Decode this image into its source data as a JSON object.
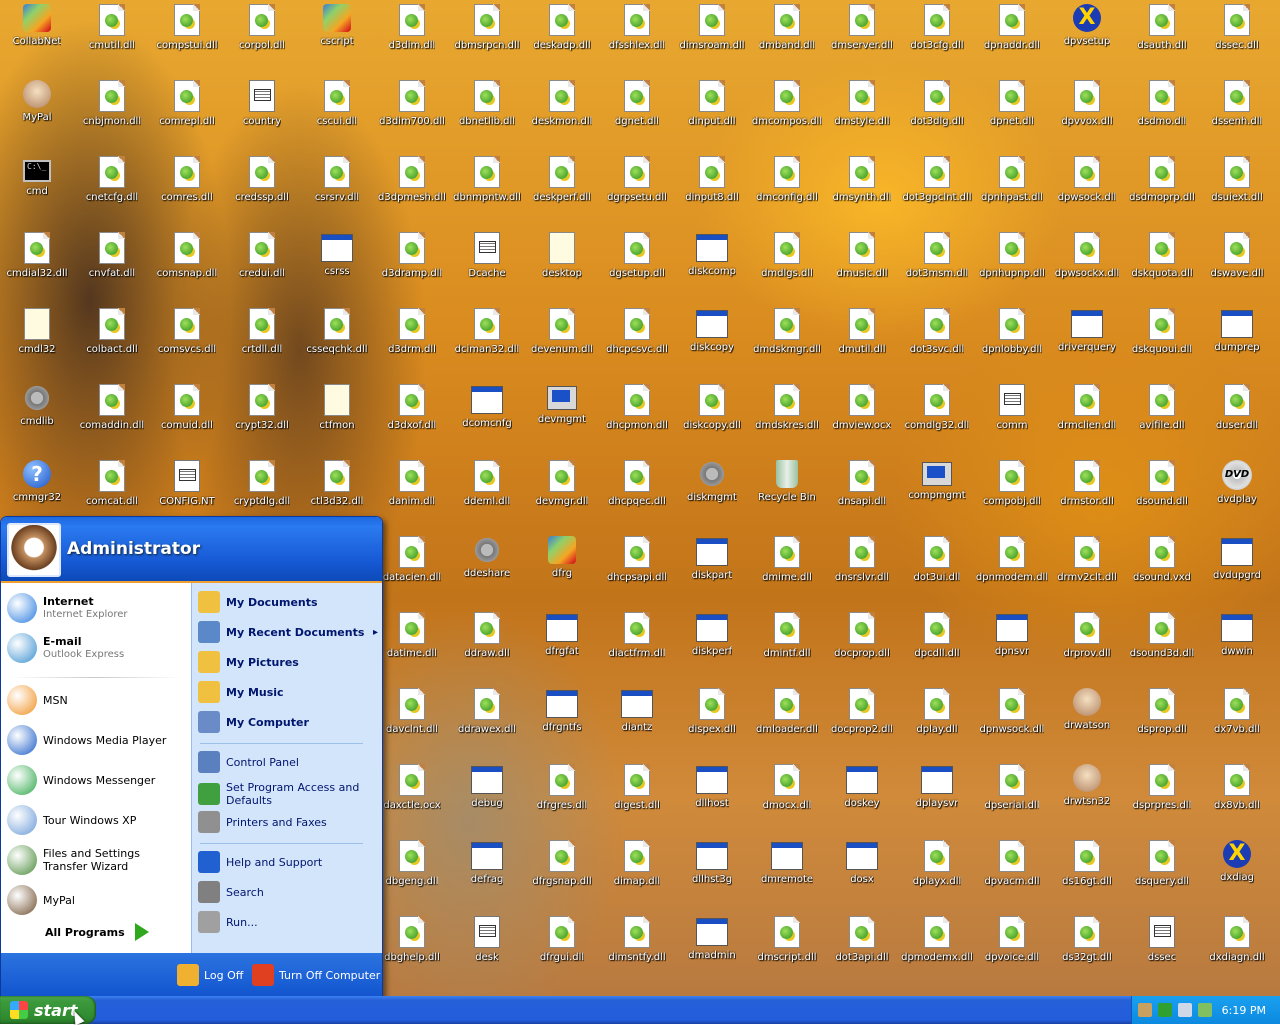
{
  "desktop": {
    "icons": [
      [
        "CollabNet",
        "cmutil.dll",
        "compstui.dll",
        "corpol.dll",
        "cscript",
        "d3dim.dll",
        "dbmsrpcn.dll",
        "deskadp.dll",
        "dfsshlex.dll",
        "dimsroam.dll",
        "dmband.dll",
        "dmserver.dll",
        "dot3cfg.dll",
        "dpnaddr.dll",
        "dpvsetup",
        "dsauth.dll",
        "dssec.dll"
      ],
      [
        "MyPal",
        "cnbjmon.dll",
        "comrepl.dll",
        "country",
        "cscui.dll",
        "d3dim700.dll",
        "dbnetlib.dll",
        "deskmon.dll",
        "dgnet.dll",
        "dinput.dll",
        "dmcompos.dll",
        "dmstyle.dll",
        "dot3dlg.dll",
        "dpnet.dll",
        "dpvvox.dll",
        "dsdmo.dll",
        "dssenh.dll"
      ],
      [
        "cmd",
        "cnetcfg.dll",
        "comres.dll",
        "credssp.dll",
        "csrsrv.dll",
        "d3dpmesh.dll",
        "dbnmpntw.dll",
        "deskperf.dll",
        "dgrpsetu.dll",
        "dinput8.dll",
        "dmconfig.dll",
        "dmsynth.dll",
        "dot3gpclnt.dll",
        "dpnhpast.dll",
        "dpwsock.dll",
        "dsdmoprp.dll",
        "dsuiext.dll"
      ],
      [
        "cmdial32.dll",
        "cnvfat.dll",
        "comsnap.dll",
        "credui.dll",
        "csrss",
        "d3dramp.dll",
        "Dcache",
        "desktop",
        "dgsetup.dll",
        "diskcomp",
        "dmdlgs.dll",
        "dmusic.dll",
        "dot3msm.dll",
        "dpnhupnp.dll",
        "dpwsockx.dll",
        "dskquota.dll",
        "dswave.dll"
      ],
      [
        "cmdl32",
        "colbact.dll",
        "comsvcs.dll",
        "crtdll.dll",
        "csseqchk.dll",
        "d3drm.dll",
        "dciman32.dll",
        "devenum.dll",
        "dhcpcsvc.dll",
        "diskcopy",
        "dmdskmgr.dll",
        "dmutil.dll",
        "dot3svc.dll",
        "dpnlobby.dll",
        "driverquery",
        "dskquoui.dll",
        "dumprep"
      ],
      [
        "cmdlib",
        "comaddin.dll",
        "comuid.dll",
        "crypt32.dll",
        "ctfmon",
        "d3dxof.dll",
        "dcomcnfg",
        "devmgmt",
        "dhcpmon.dll",
        "diskcopy.dll",
        "dmdskres.dll",
        "dmview.ocx",
        "comdlg32.dll",
        "comm",
        "drmclien.dll",
        "avifile.dll",
        "duser.dll"
      ],
      [
        "cmmgr32",
        "comcat.dll",
        "CONFIG.NT",
        "cryptdlg.dll",
        "ctl3d32.dll",
        "danim.dll",
        "ddeml.dll",
        "devmgr.dll",
        "dhcpqec.dll",
        "diskmgmt",
        "Recycle Bin",
        "dnsapi.dll",
        "compmgmt",
        "compobj.dll",
        "drmstor.dll",
        "dsound.dll",
        "dvdplay"
      ],
      [
        "",
        "",
        "",
        "",
        "",
        "datacien.dll",
        "ddeshare",
        "dfrg",
        "dhcpsapi.dll",
        "diskpart",
        "dmime.dll",
        "dnsrslvr.dll",
        "dot3ui.dll",
        "dpnmodem.dll",
        "drmv2clt.dll",
        "dsound.vxd",
        "dvdupgrd"
      ],
      [
        "",
        "",
        "",
        "",
        "",
        "datime.dll",
        "ddraw.dll",
        "dfrgfat",
        "diactfrm.dll",
        "diskperf",
        "dmintf.dll",
        "docprop.dll",
        "dpcdll.dll",
        "dpnsvr",
        "drprov.dll",
        "dsound3d.dll",
        "dwwin"
      ],
      [
        "",
        "",
        "",
        "",
        "",
        "davclnt.dll",
        "ddrawex.dll",
        "dfrgntfs",
        "diantz",
        "dispex.dll",
        "dmloader.dll",
        "docprop2.dll",
        "dplay.dll",
        "dpnwsock.dll",
        "drwatson",
        "dsprop.dll",
        "dx7vb.dll"
      ],
      [
        "",
        "",
        "",
        "",
        "",
        "daxctle.ocx",
        "debug",
        "dfrgres.dll",
        "digest.dll",
        "dllhost",
        "dmocx.dll",
        "doskey",
        "dplaysvr",
        "dpserial.dll",
        "drwtsn32",
        "dsprpres.dll",
        "dx8vb.dll"
      ],
      [
        "",
        "",
        "",
        "",
        "",
        "dbgeng.dll",
        "defrag",
        "dfrgsnap.dll",
        "dimap.dll",
        "dllhst3g",
        "dmremote",
        "dosx",
        "dplayx.dll",
        "dpvacm.dll",
        "ds16gt.dll",
        "dsquery.dll",
        "dxdiag"
      ],
      [
        "",
        "",
        "",
        "",
        "",
        "dbghelp.dll",
        "desk",
        "dfrgui.dll",
        "dimsntfy.dll",
        "dmadmin",
        "dmscript.dll",
        "dot3api.dll",
        "dpmodemx.dll",
        "dpvoice.dll",
        "ds32gt.dll",
        "dssec",
        "dxdiagn.dll"
      ]
    ]
  },
  "startmenu": {
    "username": "Administrator",
    "pinned": [
      {
        "title": "Internet",
        "subtitle": "Internet Explorer",
        "icon": "ie-icon",
        "color": "#2a7de0"
      },
      {
        "title": "E-mail",
        "subtitle": "Outlook Express",
        "icon": "outlook-express-icon",
        "color": "#3a90d0"
      }
    ],
    "recent": [
      {
        "label": "MSN",
        "icon": "msn-butterfly-icon",
        "color": "#f09020"
      },
      {
        "label": "Windows Media Player",
        "icon": "media-player-icon",
        "color": "#1c5ec8"
      },
      {
        "label": "Windows Messenger",
        "icon": "messenger-icon",
        "color": "#2fa84a"
      },
      {
        "label": "Tour Windows XP",
        "icon": "tour-icon",
        "color": "#6a9ad8"
      },
      {
        "label": "Files and Settings Transfer Wizard",
        "icon": "transfer-wizard-icon",
        "color": "#4a8a3a"
      },
      {
        "label": "MyPal",
        "icon": "mypal-icon",
        "color": "#705030"
      }
    ],
    "all_programs": "All Programs",
    "right": {
      "group1": [
        {
          "label": "My Documents",
          "icon": "folder-icon",
          "color": "#f0c040"
        },
        {
          "label": "My Recent Documents",
          "icon": "recent-docs-icon",
          "color": "#5a88c8",
          "submenu": "▸"
        },
        {
          "label": "My Pictures",
          "icon": "pictures-folder-icon",
          "color": "#f0c040"
        },
        {
          "label": "My Music",
          "icon": "music-folder-icon",
          "color": "#f0c040"
        },
        {
          "label": "My Computer",
          "icon": "computer-icon",
          "color": "#6a8ac8"
        }
      ],
      "group2": [
        {
          "label": "Control Panel",
          "icon": "control-panel-icon",
          "color": "#5a80c0"
        },
        {
          "label": "Set Program Access and Defaults",
          "icon": "program-access-icon",
          "color": "#40a040"
        },
        {
          "label": "Printers and Faxes",
          "icon": "printer-icon",
          "color": "#909090"
        }
      ],
      "group3": [
        {
          "label": "Help and Support",
          "icon": "help-icon",
          "color": "#2060d0"
        },
        {
          "label": "Search",
          "icon": "search-icon",
          "color": "#808080"
        },
        {
          "label": "Run...",
          "icon": "run-icon",
          "color": "#a0a0a0"
        }
      ]
    },
    "footer": {
      "logoff": "Log Off",
      "turnoff": "Turn Off Computer"
    }
  },
  "taskbar": {
    "start_label": "start",
    "clock": "6:19 PM"
  }
}
